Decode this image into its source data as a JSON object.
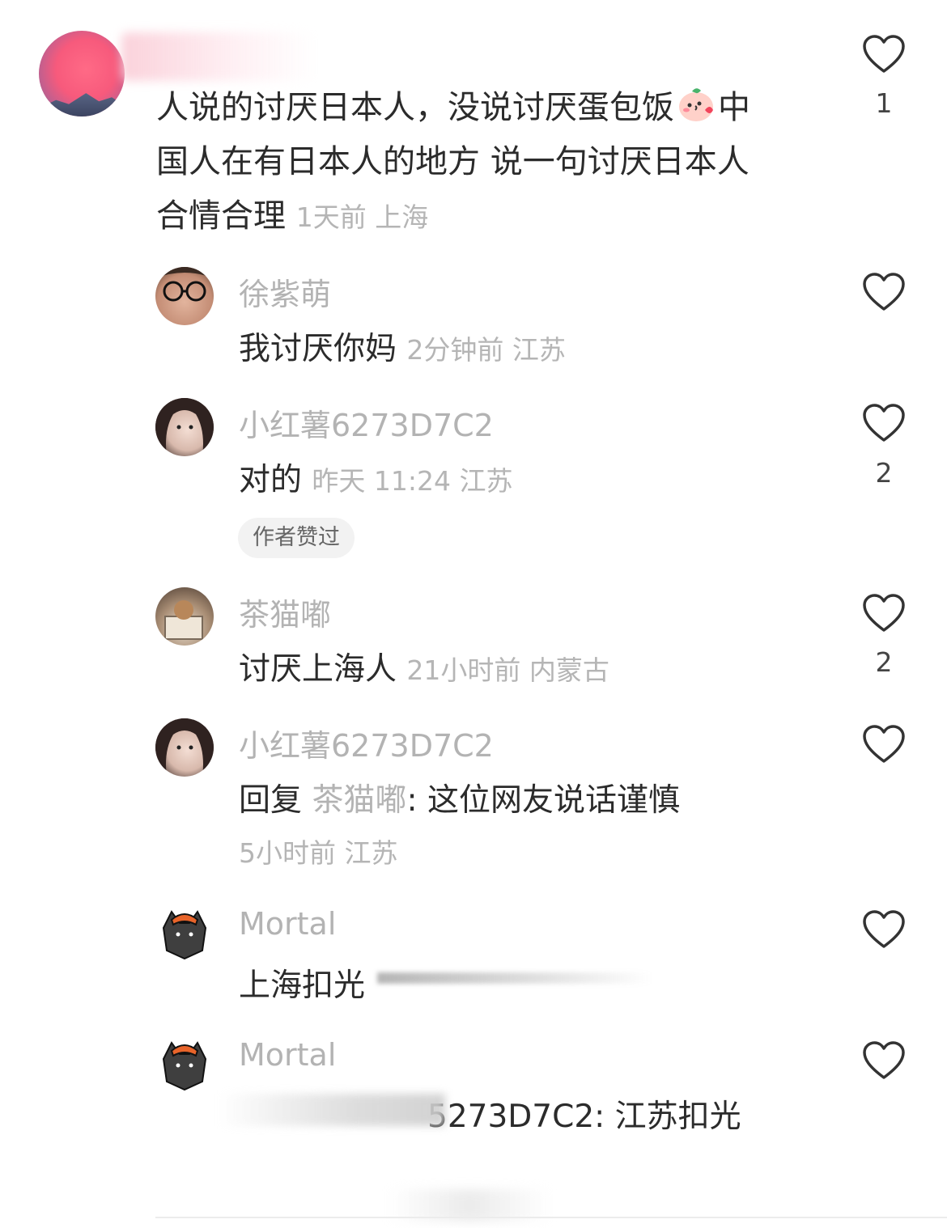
{
  "top_comment": {
    "text": "人说的讨厌日本人，没说讨厌蛋包饭",
    "text2": "中",
    "text3": "国人在有日本人的地方 说一句讨厌日本人",
    "text4": "合情合理",
    "meta": "1天前 上海",
    "like_count": "1",
    "emoji": "blushing-peach-emoji"
  },
  "replies": [
    {
      "username": "徐紫萌",
      "text": "我讨厌你妈",
      "meta": "2分钟前 江苏",
      "like_count": ""
    },
    {
      "username": "小红薯6273D7C2",
      "text": "对的",
      "meta": "昨天 11:24 江苏",
      "like_count": "2",
      "badge": "作者赞过"
    },
    {
      "username": "茶猫嘟",
      "text": "讨厌上海人",
      "meta": "21小时前 内蒙古",
      "like_count": "2"
    },
    {
      "username": "小红薯6273D7C2",
      "reply_prefix": "回复",
      "reply_to": "茶猫嘟",
      "text": ": 这位网友说话谨慎",
      "meta": "5小时前 江苏",
      "like_count": ""
    },
    {
      "username": "Mortal",
      "text": "上海扣光",
      "meta": "",
      "like_count": ""
    },
    {
      "username": "Mortal",
      "text": "5273D7C2: 江苏扣光",
      "meta": "",
      "like_count": ""
    }
  ],
  "colors": {
    "meta": "#b5b5b5",
    "text": "#2b2b2b",
    "avatar_pink": "#f75a7c"
  }
}
